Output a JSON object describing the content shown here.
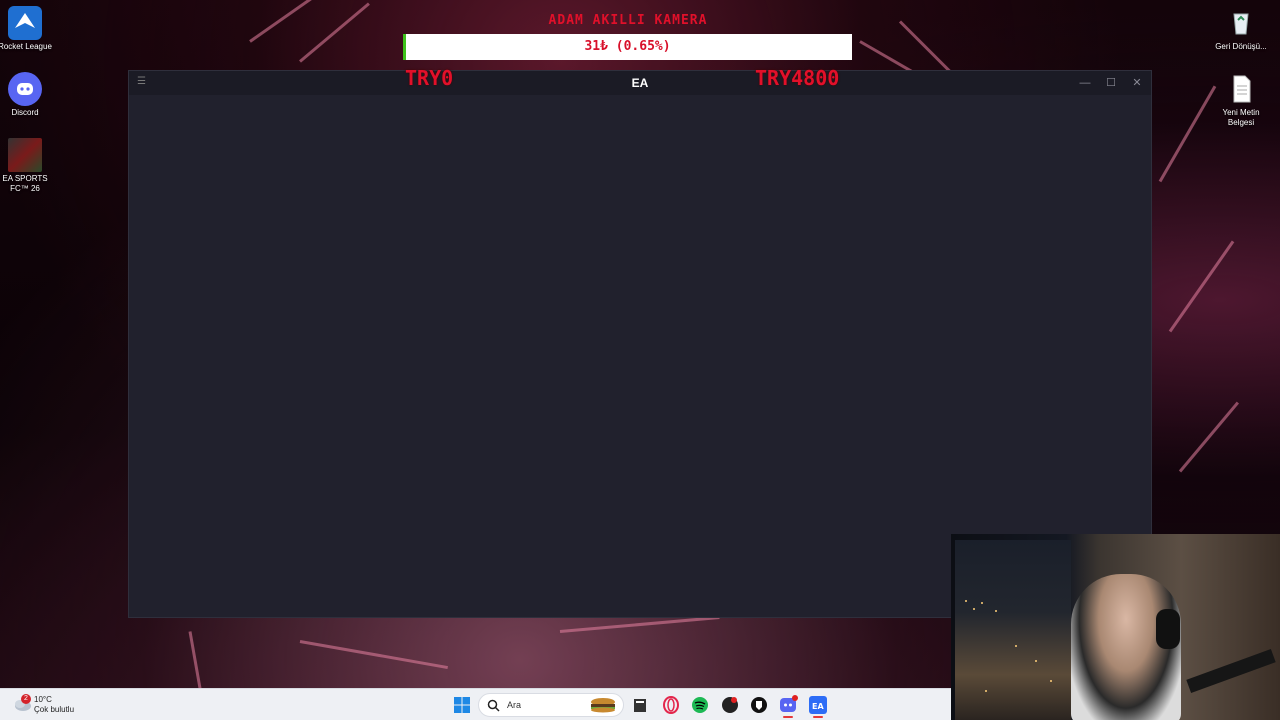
{
  "desktop": {
    "icons_left": [
      {
        "label": "Rocket League",
        "icon": "rocket-league-icon"
      },
      {
        "label": "Discord",
        "icon": "discord-icon"
      },
      {
        "label": "EA SPORTS FC™ 26",
        "icon": "ea-fc26-icon"
      }
    ],
    "icons_right": [
      {
        "label": "Geri Dönüşü...",
        "icon": "recycle-bin-icon"
      },
      {
        "label": "Yeni Metin Belgesi",
        "icon": "text-document-icon"
      }
    ]
  },
  "overlay": {
    "goal_title": "ADAM AKILLI KAMERA",
    "goal_value": "31₺ (0.65%)",
    "goal_progress": 0.0065,
    "goal_min": "TRY0",
    "goal_max": "TRY4800"
  },
  "window": {
    "title": "EA",
    "controls": {
      "menu": "☰",
      "minimize": "—",
      "maximize": "☐",
      "close": "✕"
    }
  },
  "taskbar": {
    "weather": {
      "temperature": "10°C",
      "condition": "Çok bulutlu",
      "badge": "2"
    },
    "search_placeholder": "Ara",
    "apps": [
      "windows-start-icon",
      "search-icon",
      "file-explorer-icon",
      "opera-gx-icon",
      "spotify-icon",
      "game-app-icon",
      "riot-client-icon",
      "discord-icon",
      "ea-app-icon"
    ]
  },
  "colors": {
    "overlay_red": "#e0102a",
    "progress_green": "#3ec21c",
    "window_bg": "#21212d"
  }
}
